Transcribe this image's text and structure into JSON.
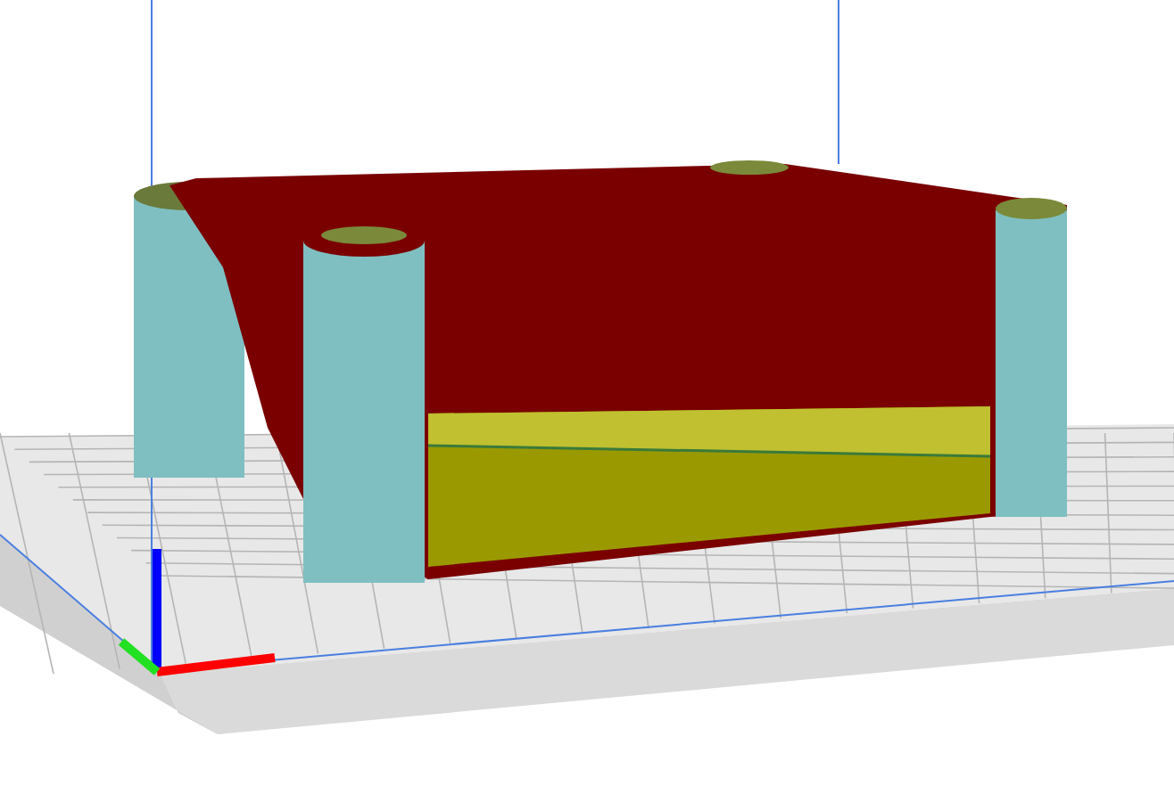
{
  "viewport": {
    "kind": "layer-view"
  }
}
